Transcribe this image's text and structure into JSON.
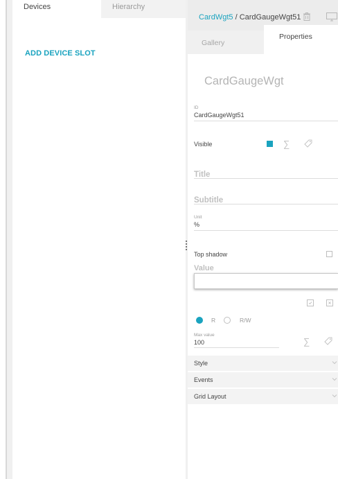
{
  "left_panel": {
    "tabs": [
      {
        "label": "Devices",
        "active": true
      },
      {
        "label": "Hierarchy",
        "active": false
      }
    ],
    "add_slot_label": "ADD DEVICE SLOT"
  },
  "right_panel": {
    "breadcrumb": {
      "parent": "CardWgt5",
      "separator": " / ",
      "current": "CardGaugeWgt51"
    },
    "tabs": [
      {
        "label": "Gallery",
        "active": false
      },
      {
        "label": "Properties",
        "active": true
      }
    ],
    "widget_title": "CardGaugeWgt",
    "id_field": {
      "label": "ID",
      "value": "CardGaugeWgt51"
    },
    "visible": {
      "label": "Visible",
      "checked": true
    },
    "title_field": {
      "label": "Title"
    },
    "subtitle_field": {
      "label": "Subtitle"
    },
    "unit_field": {
      "label": "Unit",
      "value": "%"
    },
    "top_shadow": {
      "label": "Top shadow",
      "checked": false
    },
    "value_field": {
      "label": "Value",
      "value": ""
    },
    "access_mode": {
      "options": [
        "R",
        "R/W"
      ],
      "selected": "R"
    },
    "max_value": {
      "label": "Max value",
      "value": "100"
    },
    "sections": [
      {
        "label": "Style"
      },
      {
        "label": "Events"
      },
      {
        "label": "Grid Layout"
      }
    ],
    "icons": [
      "trash-icon",
      "monitor-icon",
      "sum-icon",
      "tag-icon",
      "check-icon",
      "close-icon",
      "chevron-down-icon"
    ]
  },
  "colors": {
    "accent": "#1aa3bf",
    "panel_bg": "#ffffff",
    "app_bg": "#f0f0f0"
  }
}
